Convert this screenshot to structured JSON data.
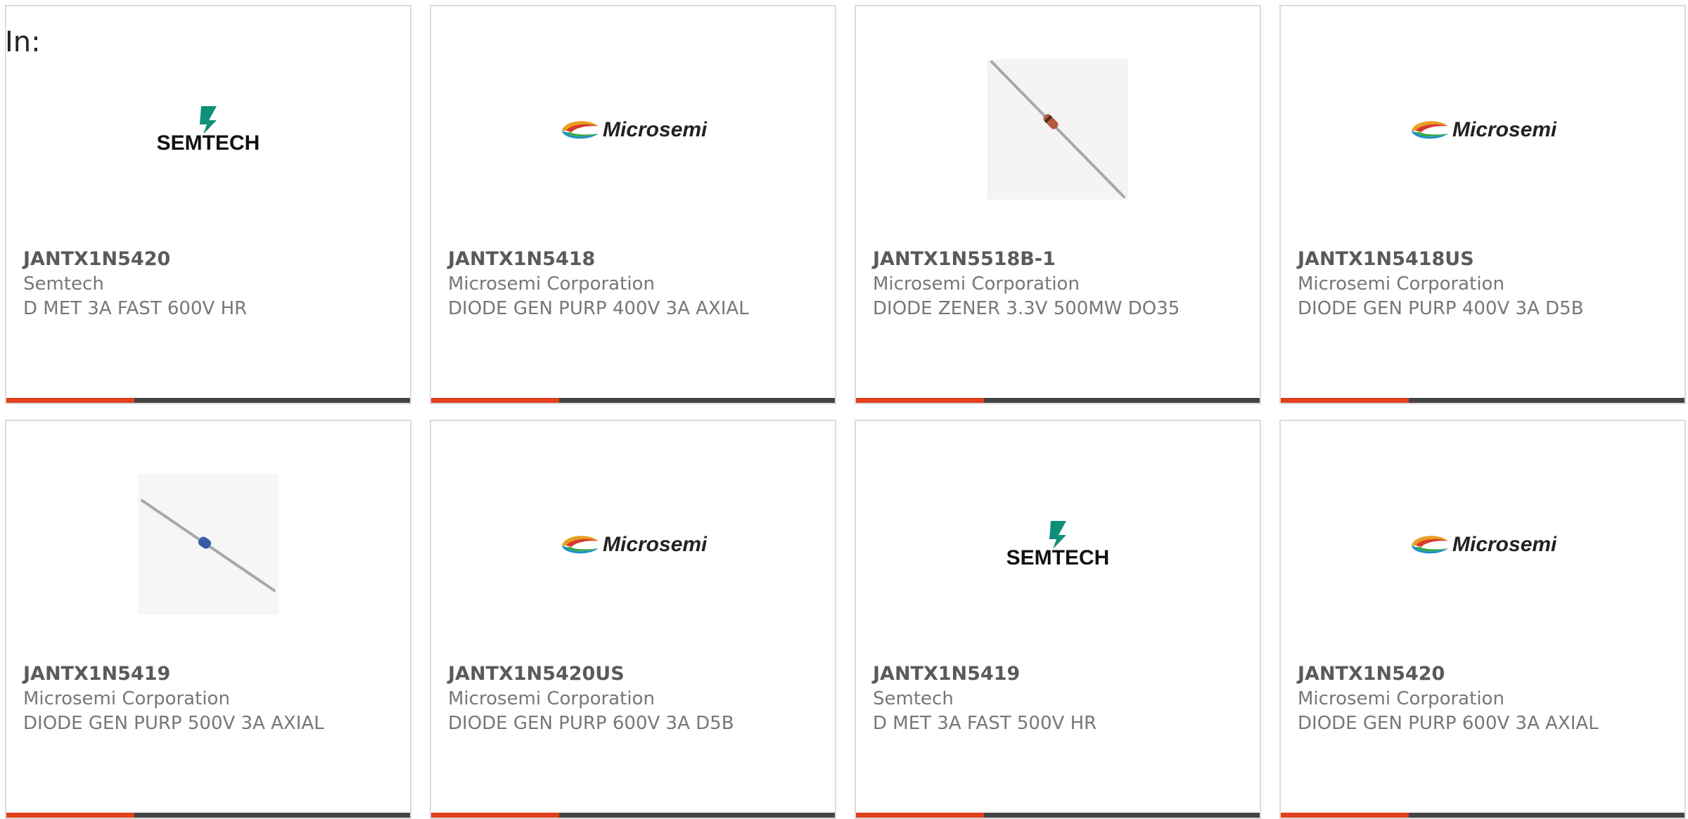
{
  "header": {
    "label": "In:"
  },
  "colors": {
    "accent": "#e0401c",
    "bar": "#444444",
    "border": "#dcdcdc",
    "semtech_green": "#0f8f7a"
  },
  "logo_text": {
    "semtech": "SEMTECH",
    "microsemi": "Microsemi"
  },
  "products": [
    {
      "part": "JANTX1N5420",
      "manufacturer": "Semtech",
      "description": "D MET 3A FAST 600V HR",
      "image": "semtech-logo"
    },
    {
      "part": "JANTX1N5418",
      "manufacturer": "Microsemi Corporation",
      "description": "DIODE GEN PURP 400V 3A AXIAL",
      "image": "microsemi-logo"
    },
    {
      "part": "JANTX1N5518B-1",
      "manufacturer": "Microsemi Corporation",
      "description": "DIODE ZENER 3.3V 500MW DO35",
      "image": "diode-red-photo"
    },
    {
      "part": "JANTX1N5418US",
      "manufacturer": "Microsemi Corporation",
      "description": "DIODE GEN PURP 400V 3A D5B",
      "image": "microsemi-logo"
    },
    {
      "part": "JANTX1N5419",
      "manufacturer": "Microsemi Corporation",
      "description": "DIODE GEN PURP 500V 3A AXIAL",
      "image": "diode-blue-photo"
    },
    {
      "part": "JANTX1N5420US",
      "manufacturer": "Microsemi Corporation",
      "description": "DIODE GEN PURP 600V 3A D5B",
      "image": "microsemi-logo"
    },
    {
      "part": "JANTX1N5419",
      "manufacturer": "Semtech",
      "description": "D MET 3A FAST 500V HR",
      "image": "semtech-logo"
    },
    {
      "part": "JANTX1N5420",
      "manufacturer": "Microsemi Corporation",
      "description": "DIODE GEN PURP 600V 3A AXIAL",
      "image": "microsemi-logo"
    }
  ]
}
